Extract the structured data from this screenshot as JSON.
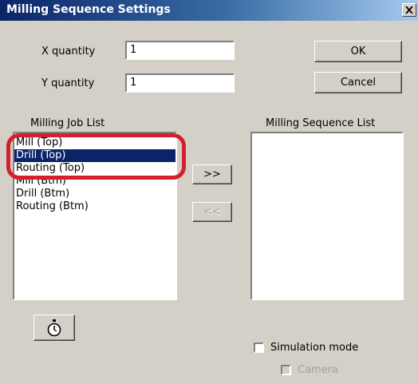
{
  "dialog": {
    "title": "Milling Sequence Settings",
    "close_glyph": "X"
  },
  "fields": {
    "x_label": "X quantity",
    "x_value": "1",
    "y_label": "Y quantity",
    "y_value": "1"
  },
  "buttons": {
    "ok": "OK",
    "cancel": "Cancel",
    "add": ">>",
    "remove": "<<"
  },
  "job_list": {
    "heading": "Milling Job List",
    "items": [
      "Mill (Top)",
      "Drill (Top)",
      "Routing (Top)",
      "Mill (Btm)",
      "Drill (Btm)",
      "Routing (Btm)"
    ],
    "selected_index": 1
  },
  "sequence_list": {
    "heading": "Milling Sequence List",
    "items": []
  },
  "options": {
    "simulation_label": "Simulation mode",
    "simulation_checked": false,
    "camera_label": "Camera",
    "camera_checked": false,
    "camera_enabled": false
  },
  "icons": {
    "timer_button": "stopwatch-icon",
    "close_button": "close-icon"
  },
  "colors": {
    "titlebar_start": "#0a246a",
    "titlebar_end": "#a6caf0",
    "selection": "#0a246a",
    "annotation_ring": "#d4202a",
    "dialog_bg": "#d4d0c8"
  }
}
